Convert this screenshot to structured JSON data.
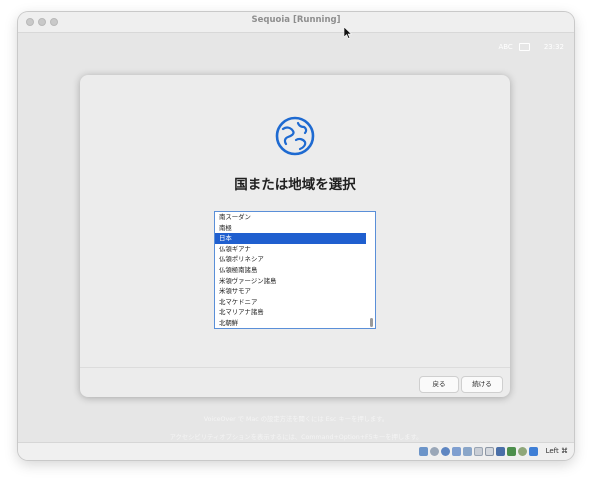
{
  "window": {
    "title": "Sequoia [Running]"
  },
  "menubar": {
    "input_mode": "ABC",
    "clock": "23:32"
  },
  "setup": {
    "heading": "国または地域を選択",
    "countries": [
      {
        "label": "南スーダン",
        "selected": false
      },
      {
        "label": "南極",
        "selected": false
      },
      {
        "label": "日本",
        "selected": true
      },
      {
        "label": "仏領ギアナ",
        "selected": false
      },
      {
        "label": "仏領ポリネシア",
        "selected": false
      },
      {
        "label": "仏領極南諸島",
        "selected": false
      },
      {
        "label": "米領ヴァージン諸島",
        "selected": false
      },
      {
        "label": "米領サモア",
        "selected": false
      },
      {
        "label": "北マケドニア",
        "selected": false
      },
      {
        "label": "北マリアナ諸島",
        "selected": false
      },
      {
        "label": "北朝鮮",
        "selected": false
      }
    ],
    "back_label": "戻る",
    "continue_label": "続ける"
  },
  "hints": {
    "voiceover": "VoiceOver で Mac の設定方法を聞くには Esc キーを押します。",
    "accessibility": "アクセシビリティオプションを表示するには、Command+Option+F5キーを押します。"
  },
  "statusbar": {
    "host_key": "Left ⌘",
    "icons": [
      "hard-disk-icon",
      "optical-drive-icon",
      "audio-icon",
      "network-icon",
      "usb-icon",
      "shared-folder-icon",
      "display-icon",
      "video-capture-icon",
      "cpu-icon",
      "mouse-integration-icon",
      "arrow-down-icon"
    ]
  },
  "colors": {
    "accent": "#1f5fcf",
    "globe": "#1e6ad1"
  }
}
